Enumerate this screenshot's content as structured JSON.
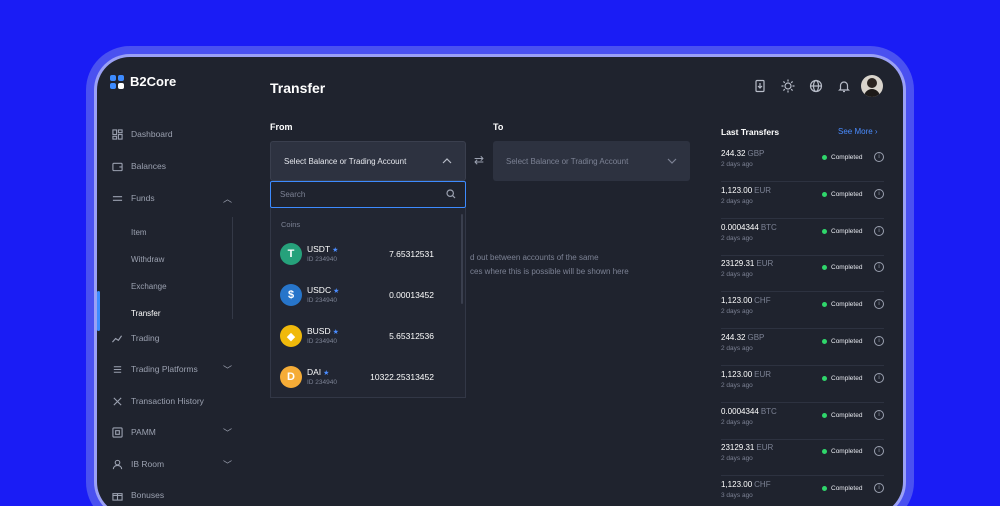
{
  "app": {
    "name": "B2Core"
  },
  "header": {
    "title": "Transfer"
  },
  "sidebar": {
    "items": [
      {
        "label": "Dashboard",
        "icon": "dashboard-icon"
      },
      {
        "label": "Balances",
        "icon": "wallet-icon"
      },
      {
        "label": "Funds",
        "icon": "funds-icon",
        "expanded": true
      },
      {
        "label": "Trading",
        "icon": "chart-icon"
      },
      {
        "label": "Trading Platforms",
        "icon": "platforms-icon"
      },
      {
        "label": "Transaction History",
        "icon": "history-icon"
      },
      {
        "label": "PAMM",
        "icon": "pamm-icon"
      },
      {
        "label": "IB Room",
        "icon": "ib-icon"
      },
      {
        "label": "Bonuses",
        "icon": "gift-icon"
      }
    ],
    "funds_sub": [
      "Item",
      "Withdraw",
      "Exchange",
      "Transfer"
    ]
  },
  "transfer": {
    "from_label": "From",
    "to_label": "To",
    "from_placeholder": "Select Balance or Trading Account",
    "to_placeholder": "Select Balance or Trading Account",
    "search_placeholder": "Search",
    "section": "Coins",
    "coins": [
      {
        "name": "USDT",
        "id": "ID 234940",
        "amount": "7.65312531",
        "color": "#26a17b",
        "glyph": "T"
      },
      {
        "name": "USDC",
        "id": "ID 234940",
        "amount": "0.00013452",
        "color": "#2775ca",
        "glyph": "$"
      },
      {
        "name": "BUSD",
        "id": "ID 234940",
        "amount": "5.65312536",
        "color": "#f0b90b",
        "glyph": "◆"
      },
      {
        "name": "DAI",
        "id": "ID 234940",
        "amount": "10322.25313452",
        "color": "#f5ac37",
        "glyph": "D"
      }
    ],
    "info_line1": "d out between accounts of the same",
    "info_line2": "ces where this is possible will be shown here"
  },
  "last_transfers": {
    "title": "Last Transfers",
    "see_more": "See More",
    "rows": [
      {
        "amount": "244.32",
        "currency": "GBP",
        "date": "2 days ago",
        "status": "Completed"
      },
      {
        "amount": "1,123.00",
        "currency": "EUR",
        "date": "2 days ago",
        "status": "Completed"
      },
      {
        "amount": "0.0004344",
        "currency": "BTC",
        "date": "2 days ago",
        "status": "Completed"
      },
      {
        "amount": "23129.31",
        "currency": "EUR",
        "date": "2 days ago",
        "status": "Completed"
      },
      {
        "amount": "1,123.00",
        "currency": "CHF",
        "date": "2 days ago",
        "status": "Completed"
      },
      {
        "amount": "244.32",
        "currency": "GBP",
        "date": "2 days ago",
        "status": "Completed"
      },
      {
        "amount": "1,123.00",
        "currency": "EUR",
        "date": "2 days ago",
        "status": "Completed"
      },
      {
        "amount": "0.0004344",
        "currency": "BTC",
        "date": "2 days ago",
        "status": "Completed"
      },
      {
        "amount": "23129.31",
        "currency": "EUR",
        "date": "2 days ago",
        "status": "Completed"
      },
      {
        "amount": "1,123.00",
        "currency": "CHF",
        "date": "3 days ago",
        "status": "Completed"
      }
    ]
  },
  "colors": {
    "background": "#1a1cf5",
    "app": "#1f232e",
    "accent": "#3d8bff",
    "success": "#2fd66b"
  }
}
